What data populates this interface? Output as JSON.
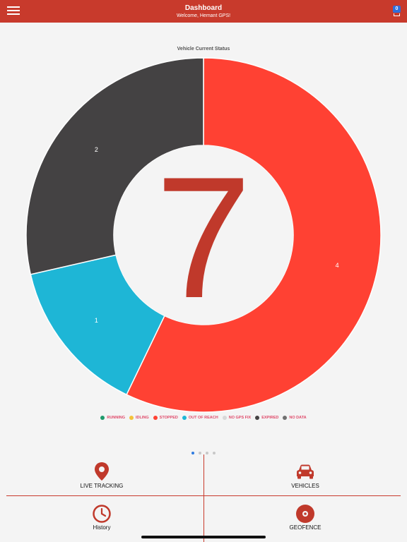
{
  "header": {
    "title": "Dashboard",
    "subtitle": "Welcome, Hemant GPS!",
    "notification_count": "0",
    "menu_icon": "hamburger-menu-icon",
    "notification_icon": "inbox-icon"
  },
  "chart_title": "Vehicle Current Status",
  "total": "7",
  "chart_data": {
    "type": "pie",
    "title": "Vehicle Current Status",
    "center_label": "7",
    "slices": [
      {
        "label": "STOPPED",
        "value": 4,
        "color": "#ff4133"
      },
      {
        "label": "OUT OF REACH",
        "value": 1,
        "color": "#1eb6d6"
      },
      {
        "label": "EXPIRED",
        "value": 2,
        "color": "#444243"
      }
    ],
    "legend": [
      {
        "label": "RUNNING",
        "color": "#1f9a6b"
      },
      {
        "label": "IDLING",
        "color": "#f4c23a"
      },
      {
        "label": "STOPPED",
        "color": "#ff4133"
      },
      {
        "label": "OUT OF REACH",
        "color": "#1eb6d6"
      },
      {
        "label": "NO GPS FIX",
        "color": "#d8d8d8"
      },
      {
        "label": "EXPIRED",
        "color": "#444243"
      },
      {
        "label": "NO DATA",
        "color": "#707070"
      }
    ],
    "legend_position": "bottom"
  },
  "pager": {
    "pages": 4,
    "active": 0
  },
  "tiles": [
    {
      "label": "LIVE TRACKING",
      "icon": "map-pin-icon"
    },
    {
      "label": "VEHICLES",
      "icon": "car-icon"
    },
    {
      "label": "History",
      "icon": "clock-icon"
    },
    {
      "label": "GEOFENCE",
      "icon": "target-icon"
    }
  ],
  "colors": {
    "brand": "#c83a2c",
    "total_number": "#c0392b"
  }
}
